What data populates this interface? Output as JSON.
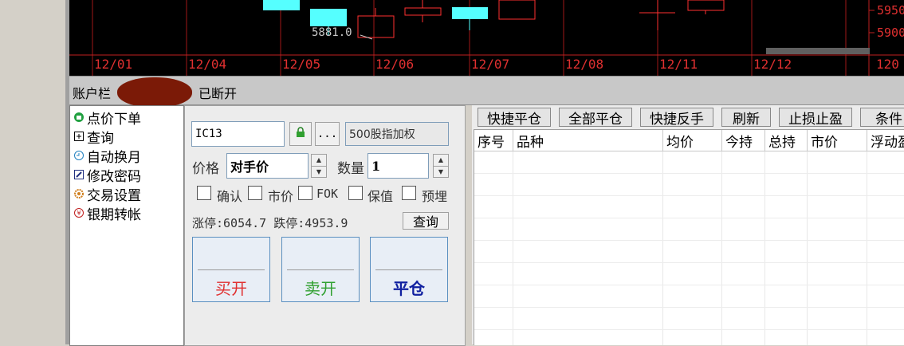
{
  "chart": {
    "dates": [
      "12/01",
      "12/04",
      "12/05",
      "12/06",
      "12/07",
      "12/08",
      "12/11",
      "12/12",
      "120"
    ],
    "prices": [
      "5950",
      "5900"
    ],
    "annotation": "5881.0"
  },
  "account": {
    "label": "账户栏",
    "status": "已断开"
  },
  "menu": [
    {
      "label": "点价下单",
      "icon": "order-icon"
    },
    {
      "label": "查询",
      "icon": "plus-box-icon"
    },
    {
      "label": "自动换月",
      "icon": "cycle-icon"
    },
    {
      "label": "修改密码",
      "icon": "edit-icon"
    },
    {
      "label": "交易设置",
      "icon": "settings-icon"
    },
    {
      "label": "银期转帐",
      "icon": "transfer-icon"
    }
  ],
  "order": {
    "contract": "IC13",
    "more_label": "...",
    "contract_name": "500股指加权",
    "price_label": "价格",
    "price_value": "对手价",
    "qty_label": "数量",
    "qty_value": "1",
    "options": [
      "确认",
      "市价",
      "FOK",
      "保值",
      "预埋"
    ],
    "limit_text": "涨停:6054.7 跌停:4953.9",
    "query_label": "查询",
    "buy_open": "买开",
    "sell_open": "卖开",
    "close": "平仓",
    "buy_color": "#e03030",
    "sell_color": "#30a030",
    "close_color": "#1020a0"
  },
  "toolbar": [
    "快捷平仓",
    "全部平仓",
    "快捷反手",
    "刷新",
    "止损止盈",
    "条件"
  ],
  "grid_headers": [
    "序号",
    "品种",
    "均价",
    "今持",
    "总持",
    "市价",
    "浮动盈"
  ]
}
